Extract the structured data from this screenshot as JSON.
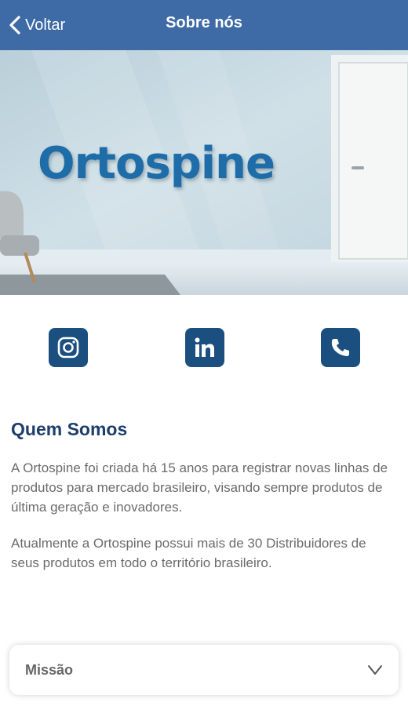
{
  "navbar": {
    "back_label": "Voltar",
    "title": "Sobre nós"
  },
  "hero": {
    "brand": "Ortospine"
  },
  "social": {
    "items": [
      {
        "name": "instagram",
        "icon": "instagram-icon"
      },
      {
        "name": "linkedin",
        "icon": "linkedin-icon"
      },
      {
        "name": "phone",
        "icon": "phone-icon"
      }
    ]
  },
  "about": {
    "title": "Quem Somos",
    "paragraphs": [
      "A Ortospine foi criada há 15 anos para registrar novas linhas de produtos para  mercado brasileiro, visando sempre produtos de última geração e inovadores.",
      "Atualmente a Ortospine possui mais de 30 Distribuidores de seus produtos em todo o território brasileiro."
    ]
  },
  "accordion": {
    "label": "Missão",
    "icon": "chevron-down-icon"
  },
  "colors": {
    "navbar": "#3e6aa6",
    "icon_bg": "#1b4f7f",
    "title": "#1d3d6b",
    "body_text": "#6b6b6b",
    "brand": "#1e6ca8"
  }
}
